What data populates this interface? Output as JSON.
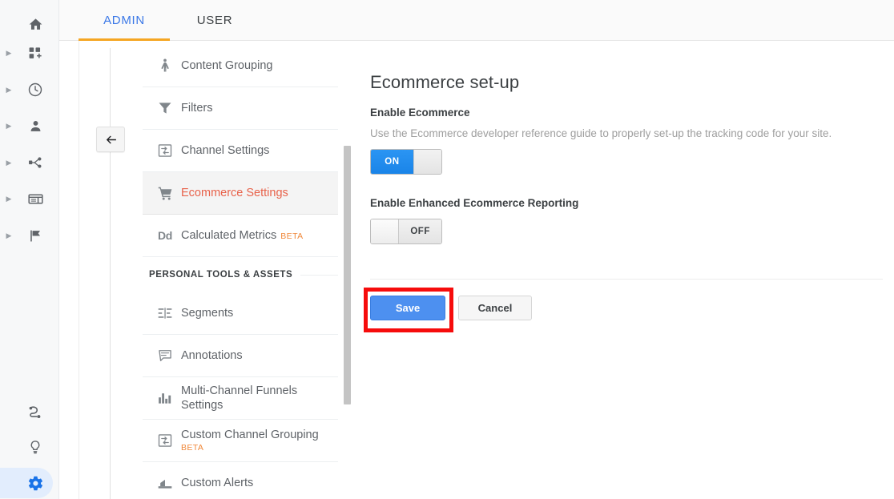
{
  "rail": {
    "items": [
      {
        "icon": "home-icon",
        "name": "home",
        "caret": false
      },
      {
        "icon": "customization-icon",
        "name": "customization",
        "caret": true
      },
      {
        "icon": "realtime-clock-icon",
        "name": "realtime",
        "caret": true
      },
      {
        "icon": "audience-person-icon",
        "name": "audience",
        "caret": true
      },
      {
        "icon": "acquisition-share-icon",
        "name": "acquisition",
        "caret": true
      },
      {
        "icon": "behavior-window-icon",
        "name": "behavior",
        "caret": true
      },
      {
        "icon": "conversions-flag-icon",
        "name": "conversions",
        "caret": true
      }
    ],
    "bottom": [
      {
        "icon": "attribution-path-icon",
        "name": "attribution"
      },
      {
        "icon": "discover-bulb-icon",
        "name": "discover"
      },
      {
        "icon": "admin-gear-icon",
        "name": "admin",
        "active": true
      }
    ],
    "active_color": "#1a73e8",
    "active_pill_color": "#e2edfd"
  },
  "tabs": {
    "admin_label": "ADMIN",
    "user_label": "USER",
    "active": "ADMIN",
    "active_text_color": "#3b78e7",
    "underline_color": "#f5a623"
  },
  "back_button": {
    "label": "back-arrow",
    "glyph": "←"
  },
  "menu": {
    "items": [
      {
        "label": "Content Grouping",
        "icon": "content-grouping-icon",
        "selected": false
      },
      {
        "label": "Filters",
        "icon": "filter-funnel-icon",
        "selected": false
      },
      {
        "label": "Channel Settings",
        "icon": "channel-settings-icon",
        "selected": false
      },
      {
        "label": "Ecommerce Settings",
        "icon": "shopping-cart-icon",
        "selected": true
      },
      {
        "label": "Calculated Metrics",
        "icon": "dd-text-icon",
        "badge": "BETA",
        "selected": false
      }
    ],
    "section_title": "PERSONAL TOOLS & ASSETS",
    "section_items": [
      {
        "label": "Segments",
        "icon": "segments-icon"
      },
      {
        "label": "Annotations",
        "icon": "annotations-bubble-icon"
      },
      {
        "label": "Multi-Channel Funnels Settings",
        "icon": "bar-chart-icon"
      },
      {
        "label": "Custom Channel Grouping",
        "icon": "channel-settings-icon",
        "badge": "BETA"
      },
      {
        "label": "Custom Alerts",
        "icon": "alerts-icon"
      }
    ],
    "selected_text_color": "#e8624a",
    "beta_color": "#f0883a"
  },
  "main": {
    "title": "Ecommerce set-up",
    "enable_ecommerce_label": "Enable Ecommerce",
    "description": "Use the Ecommerce developer reference guide to properly set-up the tracking code for your site.",
    "ecommerce_toggle": {
      "state": "ON",
      "on_label": "ON",
      "off_label": ""
    },
    "enhanced_label": "Enable Enhanced Ecommerce Reporting",
    "enhanced_toggle": {
      "state": "OFF",
      "on_label": "",
      "off_label": "OFF"
    },
    "save_label": "Save",
    "cancel_label": "Cancel",
    "highlight_color": "#f60c0c",
    "save_color": "#4d90f0"
  }
}
